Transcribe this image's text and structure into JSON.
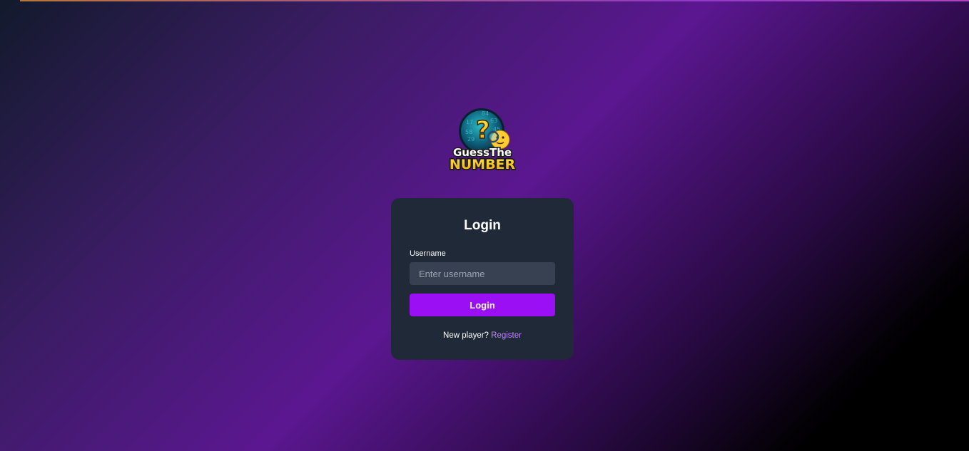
{
  "logo": {
    "line1": "GuessThe",
    "line2": "NUMBER",
    "bubble_numbers": [
      "58",
      "17",
      "63",
      "29",
      "84",
      "45"
    ]
  },
  "login": {
    "title": "Login",
    "username_label": "Username",
    "username_placeholder": "Enter username",
    "username_value": "",
    "submit_label": "Login",
    "register_prompt": "New player?",
    "register_link": "Register"
  },
  "colors": {
    "card_bg": "#1f2937",
    "input_bg": "#374151",
    "button_bg": "#9b0ff5",
    "link": "#c084fc",
    "gradient_purple": "#5b1790"
  }
}
